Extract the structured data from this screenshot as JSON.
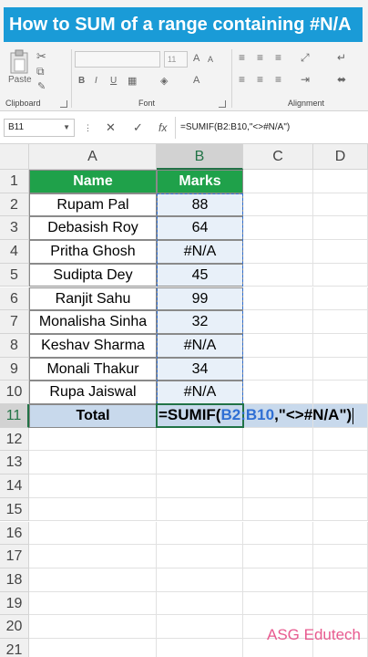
{
  "banner": {
    "title": "How to SUM of a range containing #N/A"
  },
  "ribbon": {
    "paste_label": "Paste",
    "clipboard_label": "Clipboard",
    "font_label": "Font",
    "alignment_label": "Alignment",
    "font_size": "11",
    "bold": "B",
    "italic": "I",
    "underline": "U"
  },
  "formula_bar": {
    "name_box": "B11",
    "cancel": "✕",
    "enter": "✓",
    "fx": "fx",
    "formula": "=SUMIF(B2:B10,\"<>#N/A\")"
  },
  "columns": [
    "A",
    "B",
    "C",
    "D"
  ],
  "rows": [
    "1",
    "2",
    "3",
    "4",
    "5",
    "6",
    "7",
    "8",
    "9",
    "10",
    "11",
    "12",
    "13",
    "14",
    "15",
    "16",
    "17",
    "18",
    "19",
    "20",
    "21"
  ],
  "table": {
    "header": {
      "name": "Name",
      "marks": "Marks"
    },
    "records": [
      {
        "name": "Rupam Pal",
        "marks": "88"
      },
      {
        "name": "Debasish Roy",
        "marks": "64"
      },
      {
        "name": "Pritha Ghosh",
        "marks": "#N/A"
      },
      {
        "name": "Sudipta Dey",
        "marks": "45"
      },
      {
        "name": "Ranjit Sahu",
        "marks": "99"
      },
      {
        "name": "Monalisha Sinha",
        "marks": "32"
      },
      {
        "name": "Keshav Sharma",
        "marks": "#N/A"
      },
      {
        "name": "Monali Thakur",
        "marks": "34"
      },
      {
        "name": "Rupa Jaiswal",
        "marks": "#N/A"
      }
    ],
    "total_label": "Total",
    "formula_parts": {
      "prefix": "=SUMIF(",
      "ref": "B2:B10",
      "suffix": ",\"<>#N/A\")"
    }
  },
  "watermark": "ASG Edutech",
  "colors": {
    "header_green": "#1fa14a",
    "banner_blue": "#1a9bd7",
    "selection_green": "#217346",
    "ref_blue": "#2f6fd4"
  }
}
